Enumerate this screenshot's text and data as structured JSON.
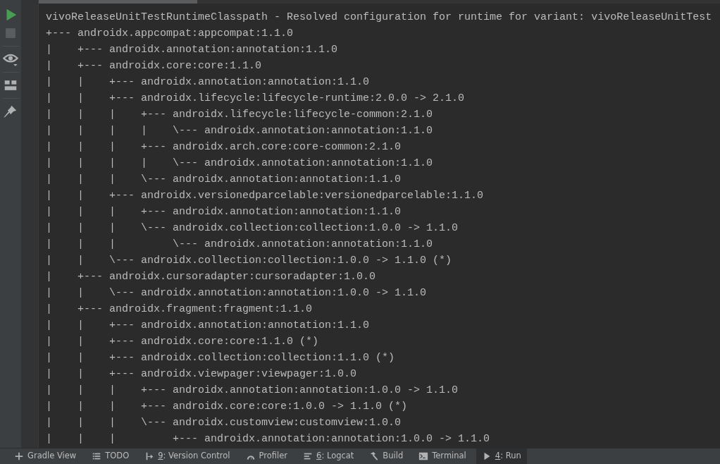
{
  "toolbar": [
    {
      "kind": "run",
      "disabled": false
    },
    {
      "kind": "stop",
      "disabled": true
    },
    {
      "kind": "separator"
    },
    {
      "kind": "view",
      "disabled": false
    },
    {
      "kind": "separator"
    },
    {
      "kind": "layout",
      "disabled": false
    },
    {
      "kind": "separator"
    },
    {
      "kind": "pin",
      "disabled": false
    }
  ],
  "console_lines": [
    "vivoReleaseUnitTestRuntimeClasspath - Resolved configuration for runtime for variant: vivoReleaseUnitTest",
    "+--- androidx.appcompat:appcompat:1.1.0",
    "|    +--- androidx.annotation:annotation:1.1.0",
    "|    +--- androidx.core:core:1.1.0",
    "|    |    +--- androidx.annotation:annotation:1.1.0",
    "|    |    +--- androidx.lifecycle:lifecycle-runtime:2.0.0 -> 2.1.0",
    "|    |    |    +--- androidx.lifecycle:lifecycle-common:2.1.0",
    "|    |    |    |    \\--- androidx.annotation:annotation:1.1.0",
    "|    |    |    +--- androidx.arch.core:core-common:2.1.0",
    "|    |    |    |    \\--- androidx.annotation:annotation:1.1.0",
    "|    |    |    \\--- androidx.annotation:annotation:1.1.0",
    "|    |    +--- androidx.versionedparcelable:versionedparcelable:1.1.0",
    "|    |    |    +--- androidx.annotation:annotation:1.1.0",
    "|    |    |    \\--- androidx.collection:collection:1.0.0 -> 1.1.0",
    "|    |    |         \\--- androidx.annotation:annotation:1.1.0",
    "|    |    \\--- androidx.collection:collection:1.0.0 -> 1.1.0 (*)",
    "|    +--- androidx.cursoradapter:cursoradapter:1.0.0",
    "|    |    \\--- androidx.annotation:annotation:1.0.0 -> 1.1.0",
    "|    +--- androidx.fragment:fragment:1.1.0",
    "|    |    +--- androidx.annotation:annotation:1.1.0",
    "|    |    +--- androidx.core:core:1.1.0 (*)",
    "|    |    +--- androidx.collection:collection:1.1.0 (*)",
    "|    |    +--- androidx.viewpager:viewpager:1.0.0",
    "|    |    |    +--- androidx.annotation:annotation:1.0.0 -> 1.1.0",
    "|    |    |    +--- androidx.core:core:1.0.0 -> 1.1.0 (*)",
    "|    |    |    \\--- androidx.customview:customview:1.0.0",
    "|    |    |         +--- androidx.annotation:annotation:1.0.0 -> 1.1.0"
  ],
  "tool_windows": [
    {
      "kind": "gradle",
      "label": "Gradle View",
      "mnemonic": false,
      "selected": false
    },
    {
      "kind": "todo",
      "label": "TODO",
      "mnemonic": false,
      "selected": false
    },
    {
      "kind": "vcs",
      "label": "9: Version Control",
      "mnemonic": true,
      "selected": false
    },
    {
      "kind": "profiler",
      "label": "Profiler",
      "mnemonic": false,
      "selected": false
    },
    {
      "kind": "logcat",
      "label": "6: Logcat",
      "mnemonic": true,
      "selected": false
    },
    {
      "kind": "build",
      "label": "Build",
      "mnemonic": false,
      "selected": false
    },
    {
      "kind": "terminal",
      "label": "Terminal",
      "mnemonic": false,
      "selected": false
    },
    {
      "kind": "run",
      "label": "4: Run",
      "mnemonic": true,
      "selected": true
    }
  ]
}
